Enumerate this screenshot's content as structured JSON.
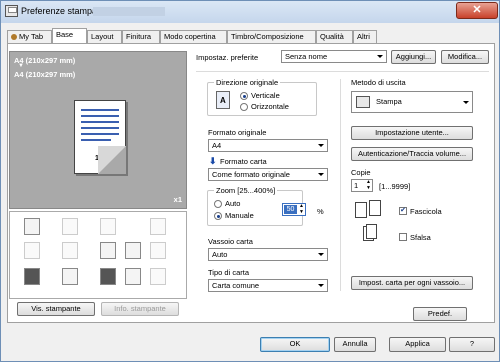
{
  "window": {
    "title": "Preferenze stampa -",
    "close_glyph": "✕"
  },
  "tabs": [
    "My Tab",
    "Base",
    "Layout",
    "Finitura",
    "Modo copertina",
    "Timbro/Composizione",
    "Qualità",
    "Altri"
  ],
  "preview": {
    "size_line1": "A4 (210x297 mm)",
    "size_line2": "A4 (210x297 mm)",
    "arrow": "▼",
    "page_number": "1",
    "copies_badge": "x1"
  },
  "left_buttons": {
    "printer_view": "Vis. stampante",
    "printer_info": "Info. stampante"
  },
  "favorites": {
    "label": "Impostaz. preferite",
    "value": "Senza nome",
    "add": "Aggiungi...",
    "edit": "Modifica..."
  },
  "orientation": {
    "title": "Direzione originale",
    "portrait": "Verticale",
    "landscape": "Orizzontale",
    "selected": "portrait"
  },
  "original_size": {
    "label": "Formato originale",
    "value": "A4"
  },
  "paper_size": {
    "label": "Formato carta",
    "value": "Come formato originale"
  },
  "zoom": {
    "title": "Zoom [25...400%]",
    "auto": "Auto",
    "manual": "Manuale",
    "value": "50",
    "unit": "%",
    "selected": "manual"
  },
  "paper_tray": {
    "label": "Vassoio carta",
    "value": "Auto"
  },
  "paper_type": {
    "label": "Tipo di carta",
    "value": "Carta comune"
  },
  "output": {
    "label": "Metodo di uscita",
    "value": "Stampa"
  },
  "buttons": {
    "user_settings": "Impostazione utente...",
    "auth": "Autenticazione/Traccia volume...",
    "paper_per_tray": "Impost. carta per ogni vassoio..."
  },
  "copies": {
    "label": "Copie",
    "value": "1",
    "range": "[1...9999]"
  },
  "collate": {
    "label": "Fascicola",
    "checked": true
  },
  "offset": {
    "label": "Sfalsa",
    "checked": false
  },
  "default_button": "Predef.",
  "dialog_buttons": {
    "ok": "OK",
    "cancel": "Annulla",
    "apply": "Applica",
    "help": "?"
  }
}
